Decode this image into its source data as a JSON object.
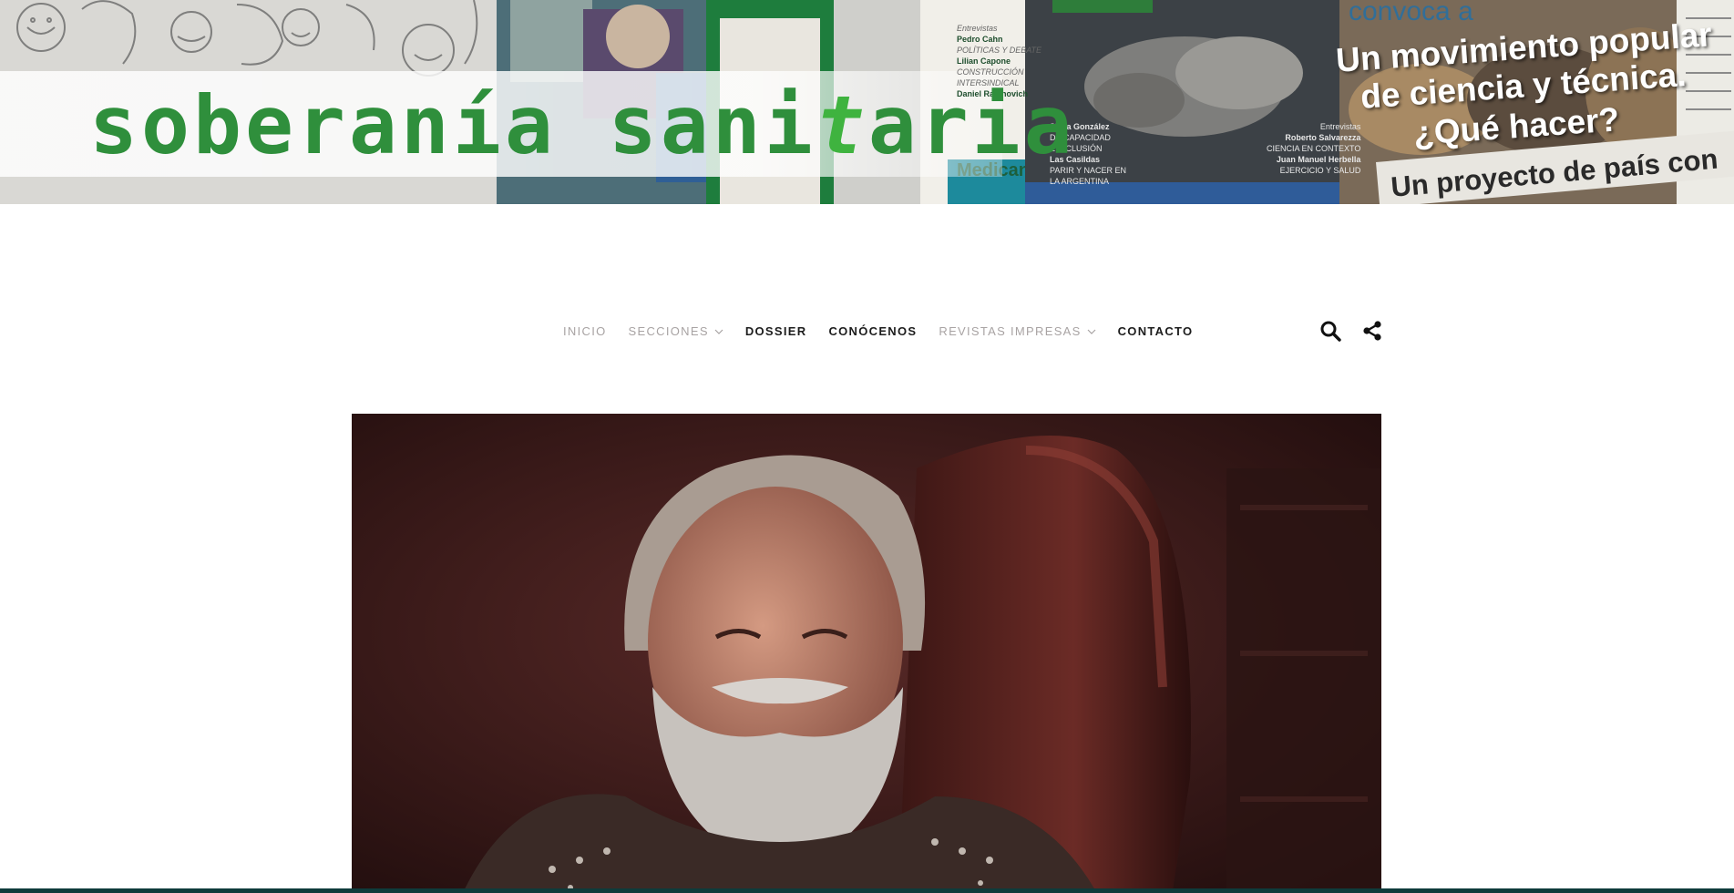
{
  "header": {
    "logo_part1": "soberanía sani",
    "logo_accent": "t",
    "logo_part2": "aria",
    "magazine_headline": [
      "Un movimiento popular",
      "de ciencia y técnica.",
      "¿Qué hacer?"
    ],
    "magazine_strap": "Un proyecto de país con",
    "cover_credits": [
      "Silvia González",
      "DISCAPACIDAD",
      "E INCLUSIÓN",
      "Las Casildas",
      "PARIR Y NACER EN",
      "LA ARGENTINA"
    ],
    "cover_credits_right": [
      "Entrevistas",
      "Roberto Salvarezza",
      "CIENCIA EN CONTEXTO",
      "Juan Manuel Herbella",
      "EJERCICIO Y SALUD"
    ],
    "interview_list": [
      "Entrevistas",
      "Pedro Cahn",
      "POLÍTICAS Y DEBATE",
      "Lilian Capone",
      "CONSTRUCCIÓN",
      "INTERSINDICAL",
      "Daniel Rabinovich"
    ],
    "colors": {
      "logo_green": "#2f8f3c",
      "logo_accent_green": "#3fb33f",
      "footer_strip": "#0e3b3b"
    }
  },
  "nav": {
    "items": [
      {
        "label": "INICIO",
        "style": "dim",
        "dropdown": false
      },
      {
        "label": "SECCIONES",
        "style": "dim",
        "dropdown": true
      },
      {
        "label": "DOSSIER",
        "style": "bold",
        "dropdown": false
      },
      {
        "label": "CONÓCENOS",
        "style": "bold",
        "dropdown": false
      },
      {
        "label": "REVISTAS IMPRESAS",
        "style": "dim",
        "dropdown": true
      },
      {
        "label": "CONTACTO",
        "style": "bold",
        "dropdown": false
      }
    ],
    "icons": [
      "search-icon",
      "share-icon"
    ]
  },
  "hero": {
    "subject": "portrait-photo"
  }
}
